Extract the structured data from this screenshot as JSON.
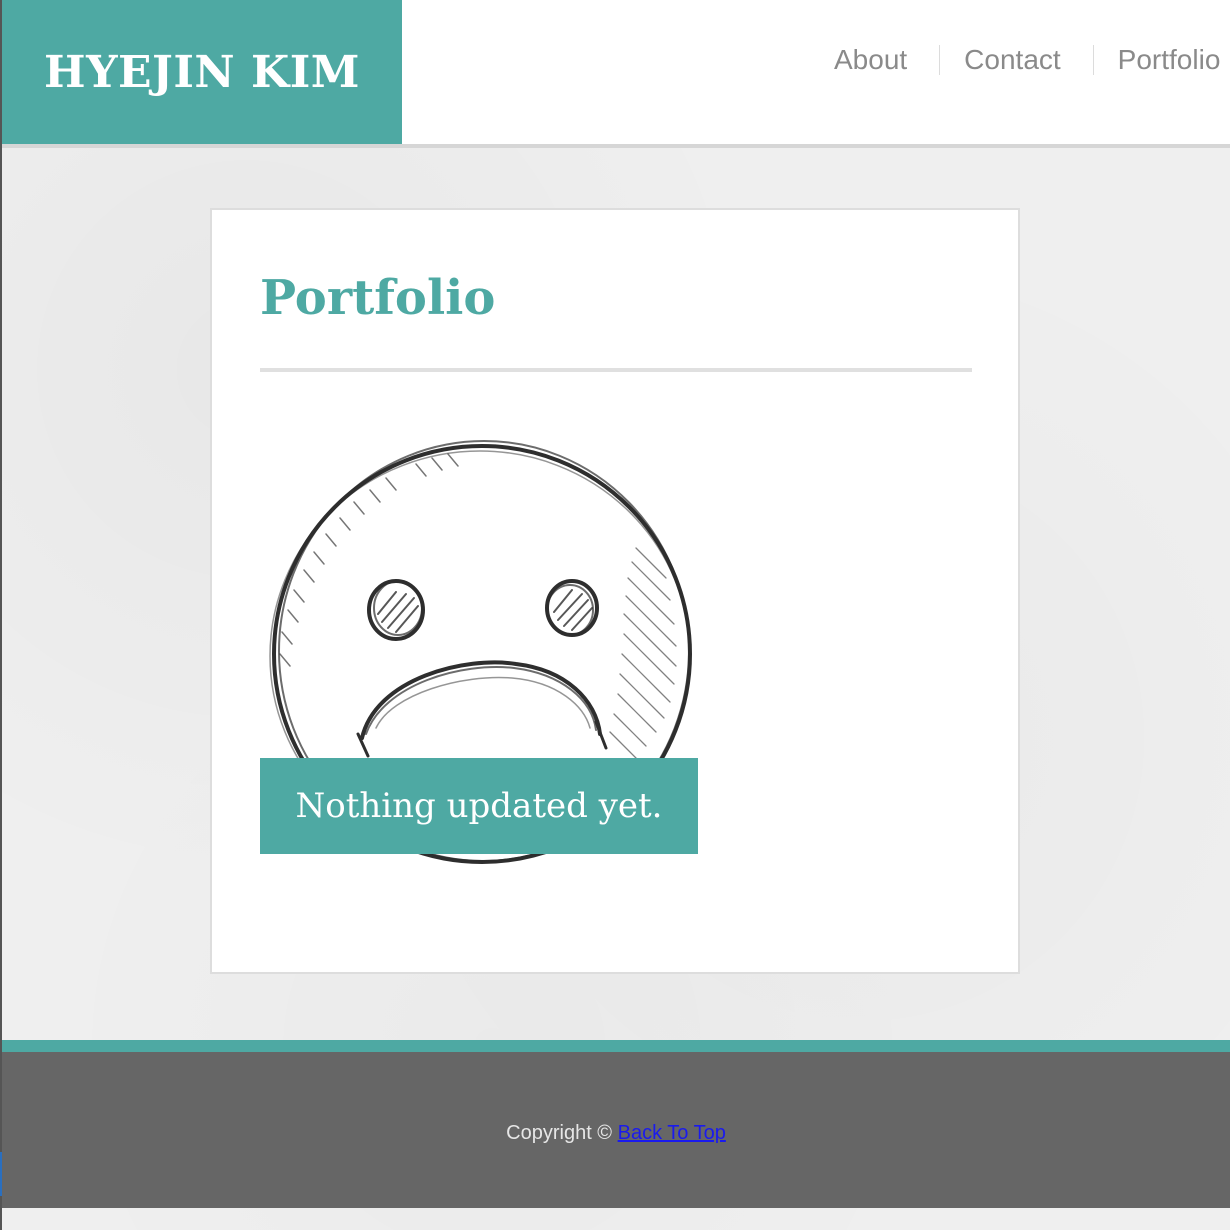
{
  "header": {
    "brand": "HYEJIN KIM",
    "nav": [
      {
        "label": "About"
      },
      {
        "label": "Contact"
      },
      {
        "label": "Portfolio"
      }
    ]
  },
  "main": {
    "title": "Portfolio",
    "image": {
      "icon": "sad-face-sketch-icon"
    },
    "caption": "Nothing updated yet."
  },
  "footer": {
    "copyright": "Copyright ©",
    "back_to_top": "Back To Top"
  },
  "colors": {
    "accent": "#4ea9a3",
    "footer_bg": "#666666",
    "link": "#1a1aee",
    "nav_text": "#8a8a8a"
  }
}
